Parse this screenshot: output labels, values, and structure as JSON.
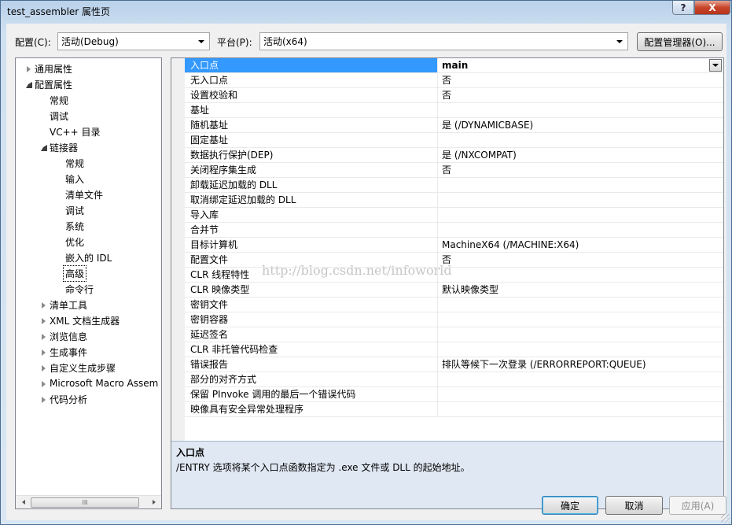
{
  "window": {
    "title": "test_assembler 属性页",
    "help_label": "?",
    "close_label": "X"
  },
  "toolbar": {
    "config_label": "配置(C):",
    "config_value": "活动(Debug)",
    "platform_label": "平台(P):",
    "platform_value": "活动(x64)",
    "config_manager_label": "配置管理器(O)..."
  },
  "tree": {
    "items": [
      {
        "label": "通用属性",
        "level": 0,
        "state": "collapsed"
      },
      {
        "label": "配置属性",
        "level": 0,
        "state": "expanded"
      },
      {
        "label": "常规",
        "level": 1,
        "state": "leaf"
      },
      {
        "label": "调试",
        "level": 1,
        "state": "leaf"
      },
      {
        "label": "VC++ 目录",
        "level": 1,
        "state": "leaf"
      },
      {
        "label": "链接器",
        "level": 1,
        "state": "expanded"
      },
      {
        "label": "常规",
        "level": 2,
        "state": "leaf"
      },
      {
        "label": "输入",
        "level": 2,
        "state": "leaf"
      },
      {
        "label": "清单文件",
        "level": 2,
        "state": "leaf"
      },
      {
        "label": "调试",
        "level": 2,
        "state": "leaf"
      },
      {
        "label": "系统",
        "level": 2,
        "state": "leaf"
      },
      {
        "label": "优化",
        "level": 2,
        "state": "leaf"
      },
      {
        "label": "嵌入的 IDL",
        "level": 2,
        "state": "leaf"
      },
      {
        "label": "高级",
        "level": 2,
        "state": "selected"
      },
      {
        "label": "命令行",
        "level": 2,
        "state": "leaf"
      },
      {
        "label": "清单工具",
        "level": 1,
        "state": "collapsed"
      },
      {
        "label": "XML 文档生成器",
        "level": 1,
        "state": "collapsed"
      },
      {
        "label": "浏览信息",
        "level": 1,
        "state": "collapsed"
      },
      {
        "label": "生成事件",
        "level": 1,
        "state": "collapsed"
      },
      {
        "label": "自定义生成步骤",
        "level": 1,
        "state": "collapsed"
      },
      {
        "label": "Microsoft Macro Assem",
        "level": 1,
        "state": "collapsed"
      },
      {
        "label": "代码分析",
        "level": 1,
        "state": "collapsed"
      }
    ],
    "scroll_thumb_glyph": "III"
  },
  "properties": [
    {
      "name": "入口点",
      "value": "main"
    },
    {
      "name": "无入口点",
      "value": "否"
    },
    {
      "name": "设置校验和",
      "value": "否"
    },
    {
      "name": "基址",
      "value": ""
    },
    {
      "name": "随机基址",
      "value": "是 (/DYNAMICBASE)"
    },
    {
      "name": "固定基址",
      "value": ""
    },
    {
      "name": "数据执行保护(DEP)",
      "value": "是 (/NXCOMPAT)"
    },
    {
      "name": "关闭程序集生成",
      "value": "否"
    },
    {
      "name": "卸载延迟加载的 DLL",
      "value": ""
    },
    {
      "name": "取消绑定延迟加载的 DLL",
      "value": ""
    },
    {
      "name": "导入库",
      "value": ""
    },
    {
      "name": "合并节",
      "value": ""
    },
    {
      "name": "目标计算机",
      "value": "MachineX64 (/MACHINE:X64)"
    },
    {
      "name": "配置文件",
      "value": "否"
    },
    {
      "name": "CLR 线程特性",
      "value": ""
    },
    {
      "name": "CLR 映像类型",
      "value": "默认映像类型"
    },
    {
      "name": "密钥文件",
      "value": ""
    },
    {
      "name": "密钥容器",
      "value": ""
    },
    {
      "name": "延迟签名",
      "value": ""
    },
    {
      "name": "CLR 非托管代码检查",
      "value": ""
    },
    {
      "name": "错误报告",
      "value": "排队等候下一次登录 (/ERRORREPORT:QUEUE)"
    },
    {
      "name": "部分的对齐方式",
      "value": ""
    },
    {
      "name": "保留 PInvoke 调用的最后一个错误代码",
      "value": ""
    },
    {
      "name": "映像具有安全异常处理程序",
      "value": ""
    }
  ],
  "description": {
    "title": "入口点",
    "text": "/ENTRY 选项将某个入口点函数指定为 .exe 文件或 DLL 的起始地址。"
  },
  "watermark": "http://blog.csdn.net/infoworld",
  "buttons": {
    "ok": "确定",
    "cancel": "取消",
    "apply": "应用(A)"
  },
  "colors": {
    "selection": "#3399ff",
    "description_bg": "#dfe8f3"
  }
}
